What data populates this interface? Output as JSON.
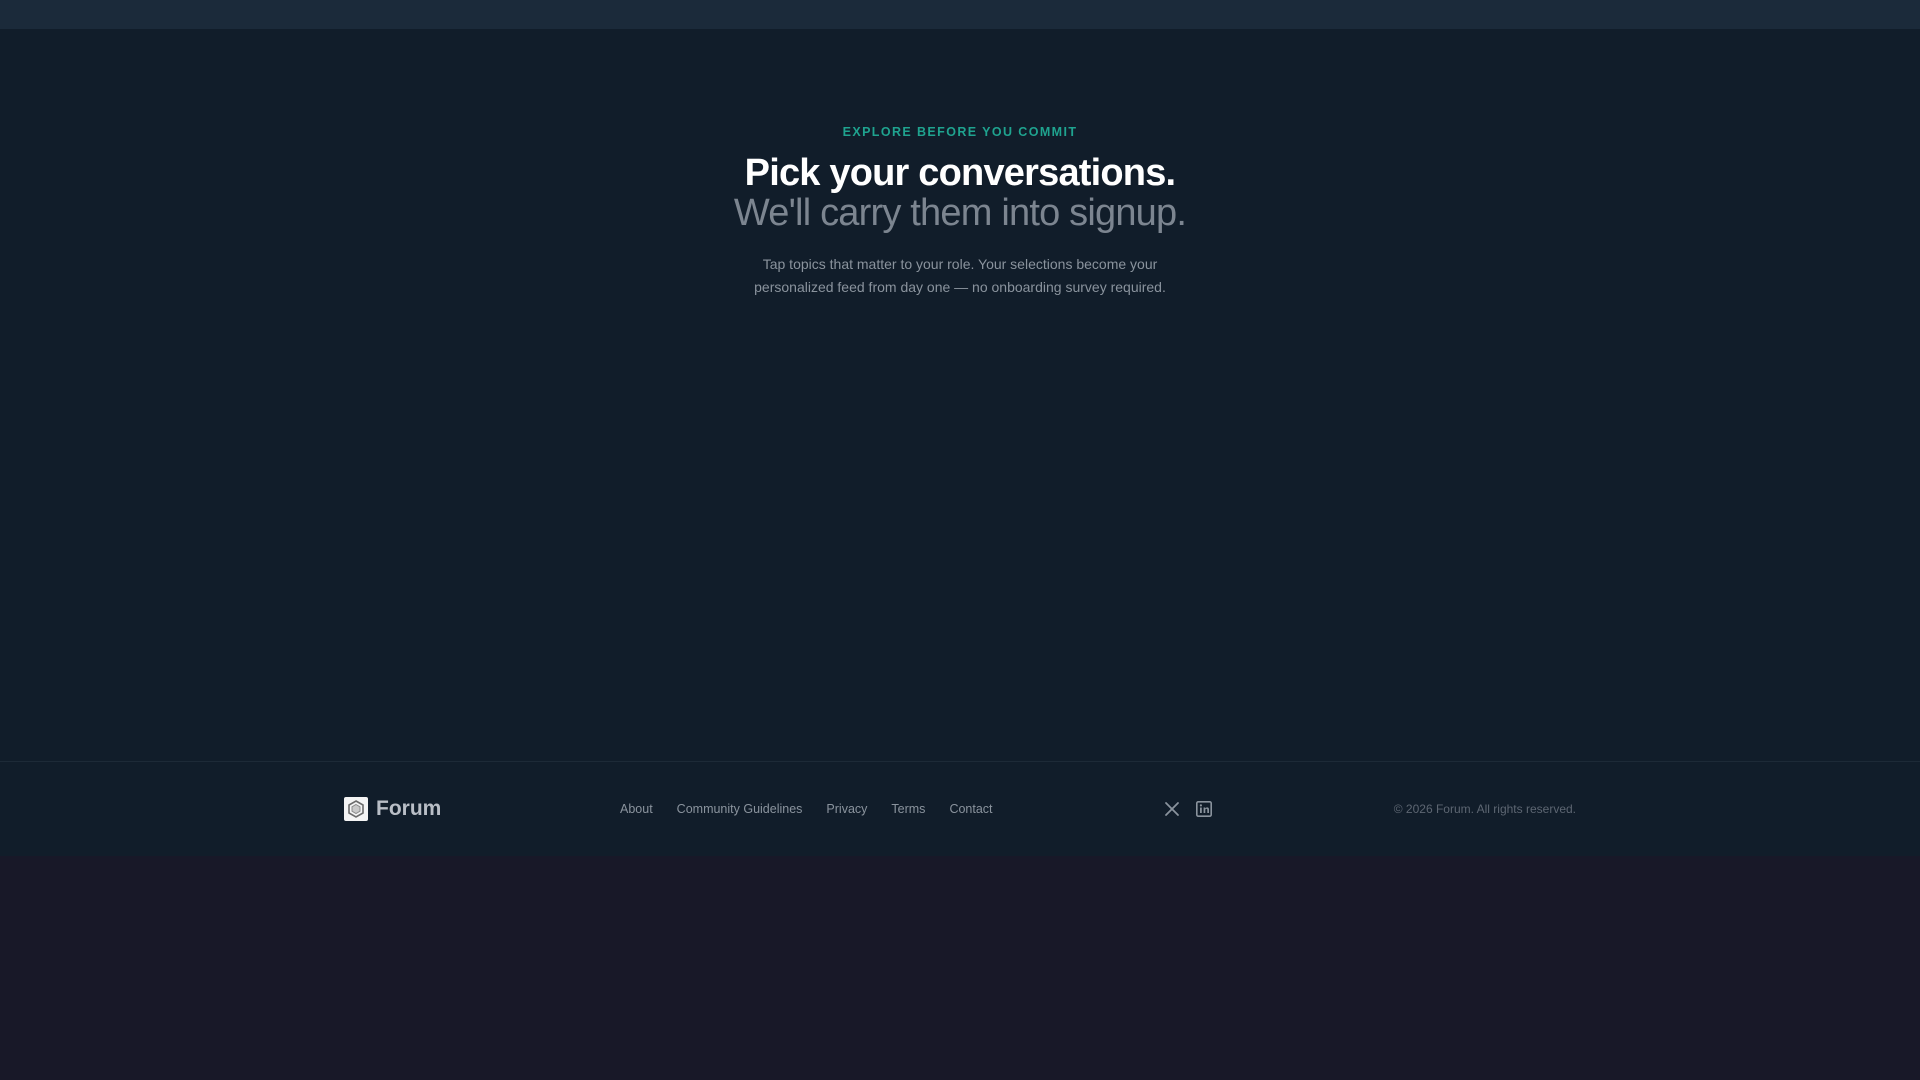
{
  "hero": {
    "eyebrow": "EXPLORE BEFORE YOU COMMIT",
    "headline_line1": "Pick your conversations.",
    "headline_line2": "We'll carry them into signup.",
    "subtext_line1": "Tap topics that matter to your role. Your selections become your",
    "subtext_line2": "personalized feed from day one — no onboarding survey required."
  },
  "footer": {
    "brand_name": "Forum",
    "brand_icon": "hexagon-logo-icon",
    "links": [
      "About",
      "Community Guidelines",
      "Privacy",
      "Terms",
      "Contact"
    ],
    "social_icons": [
      "x-icon",
      "linkedin-icon"
    ],
    "copyright": "© 2026 Forum. All rights reserved."
  },
  "colors": {
    "accent": "#1fa38f",
    "background": "#111d2a",
    "topbar": "#1b2a3a",
    "page_bottom": "#181828"
  }
}
